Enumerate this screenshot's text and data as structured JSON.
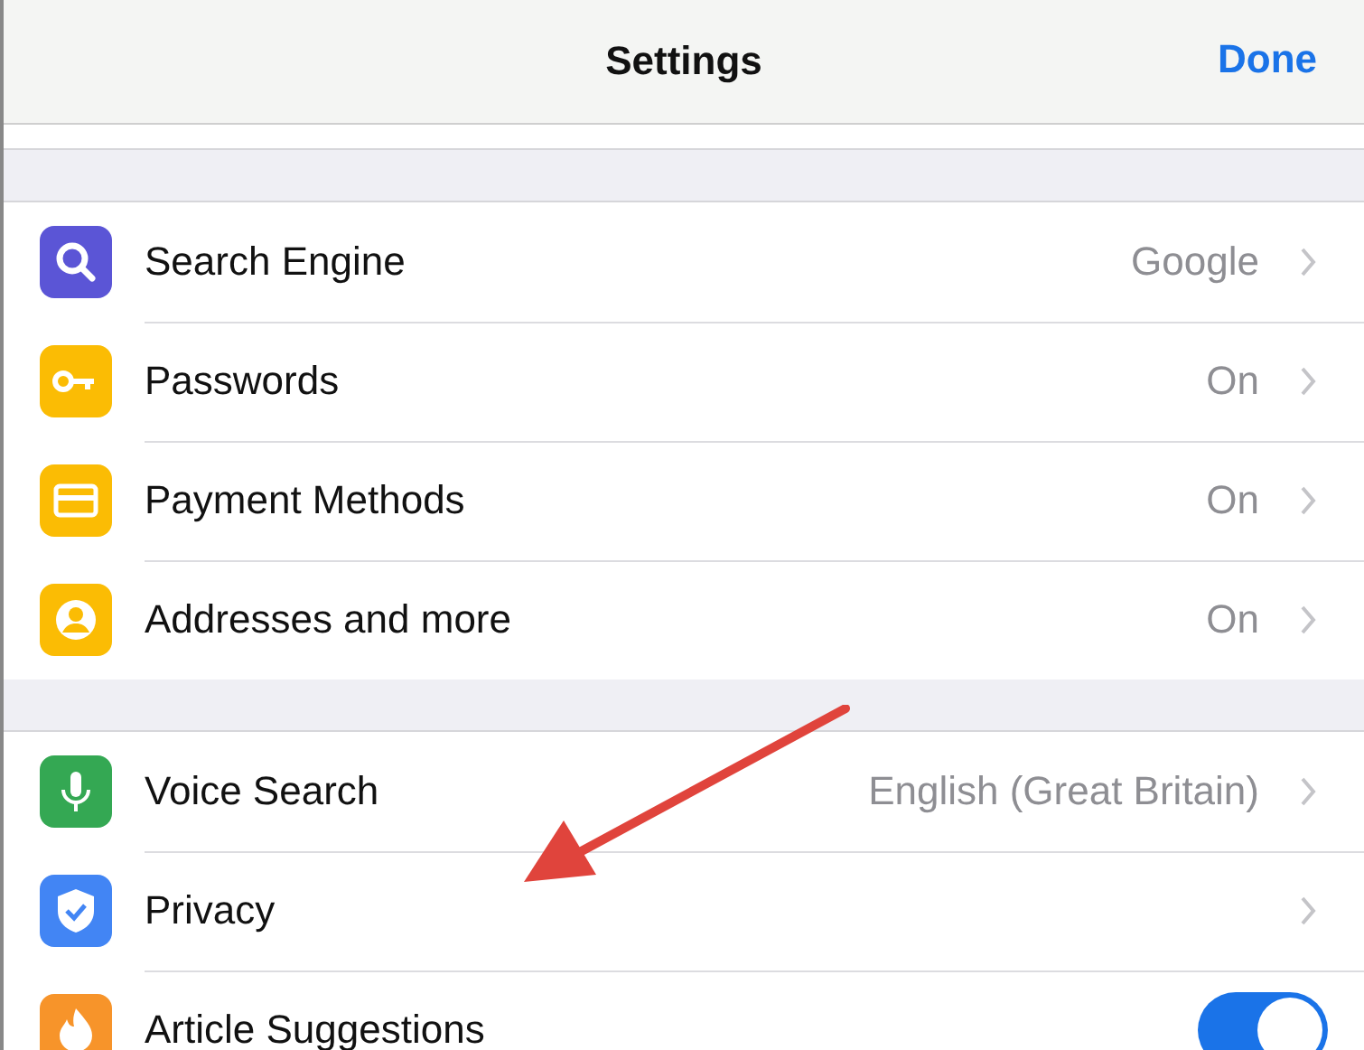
{
  "header": {
    "title": "Settings",
    "done": "Done"
  },
  "sections": [
    {
      "rows": [
        {
          "kind": "link",
          "label": "Search Engine",
          "value": "Google",
          "color": "#5b55d6"
        },
        {
          "kind": "link",
          "label": "Passwords",
          "value": "On",
          "color": "#fbbc04"
        },
        {
          "kind": "link",
          "label": "Payment Methods",
          "value": "On",
          "color": "#fbbc04"
        },
        {
          "kind": "link",
          "label": "Addresses and more",
          "value": "On",
          "color": "#fbbc04"
        }
      ]
    },
    {
      "rows": [
        {
          "kind": "link",
          "label": "Voice Search",
          "value": "English (Great Britain)",
          "color": "#34a853"
        },
        {
          "kind": "link",
          "label": "Privacy",
          "color": "#4285f4"
        },
        {
          "kind": "toggle",
          "label": "Article Suggestions",
          "on": true,
          "color": "#f7942a"
        }
      ]
    }
  ]
}
